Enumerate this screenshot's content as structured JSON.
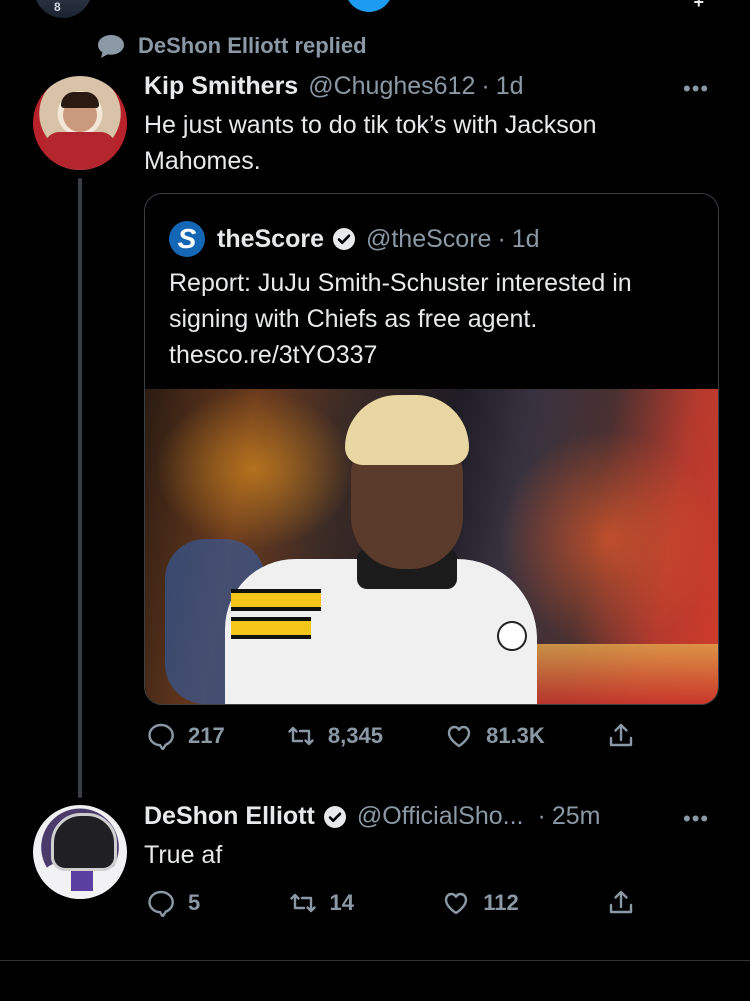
{
  "top": {
    "avatar_badge": "8"
  },
  "context": {
    "replied_text": "DeShon Elliott replied"
  },
  "tweet1": {
    "name": "Kip Smithers",
    "handle": "@Chughes612",
    "time": "1d",
    "text": "He just wants to do tik tok’s with Jackson Mahomes.",
    "quote": {
      "name": "theScore",
      "handle": "@theScore",
      "time": "1d",
      "text": "Report: JuJu Smith-Schuster interested in signing with Chiefs as free agent.",
      "link": "thesco.re/3tYO337",
      "logo_letter": "S"
    },
    "stats": {
      "replies": "217",
      "retweets": "8,345",
      "likes": "81.3K"
    }
  },
  "tweet2": {
    "name": "DeShon Elliott",
    "handle": "@OfficialSho...",
    "time": "25m",
    "text": "True af",
    "stats": {
      "replies": "5",
      "retweets": "14",
      "likes": "112"
    }
  },
  "colors": {
    "background": "#000000",
    "text": "#e7e9ea",
    "secondary": "#8b98a5",
    "verified": "#1d9bf0",
    "border": "#3a3f44"
  },
  "icons": [
    "reply-icon",
    "retweet-icon",
    "like-icon",
    "share-icon",
    "verified-icon",
    "more-icon"
  ]
}
